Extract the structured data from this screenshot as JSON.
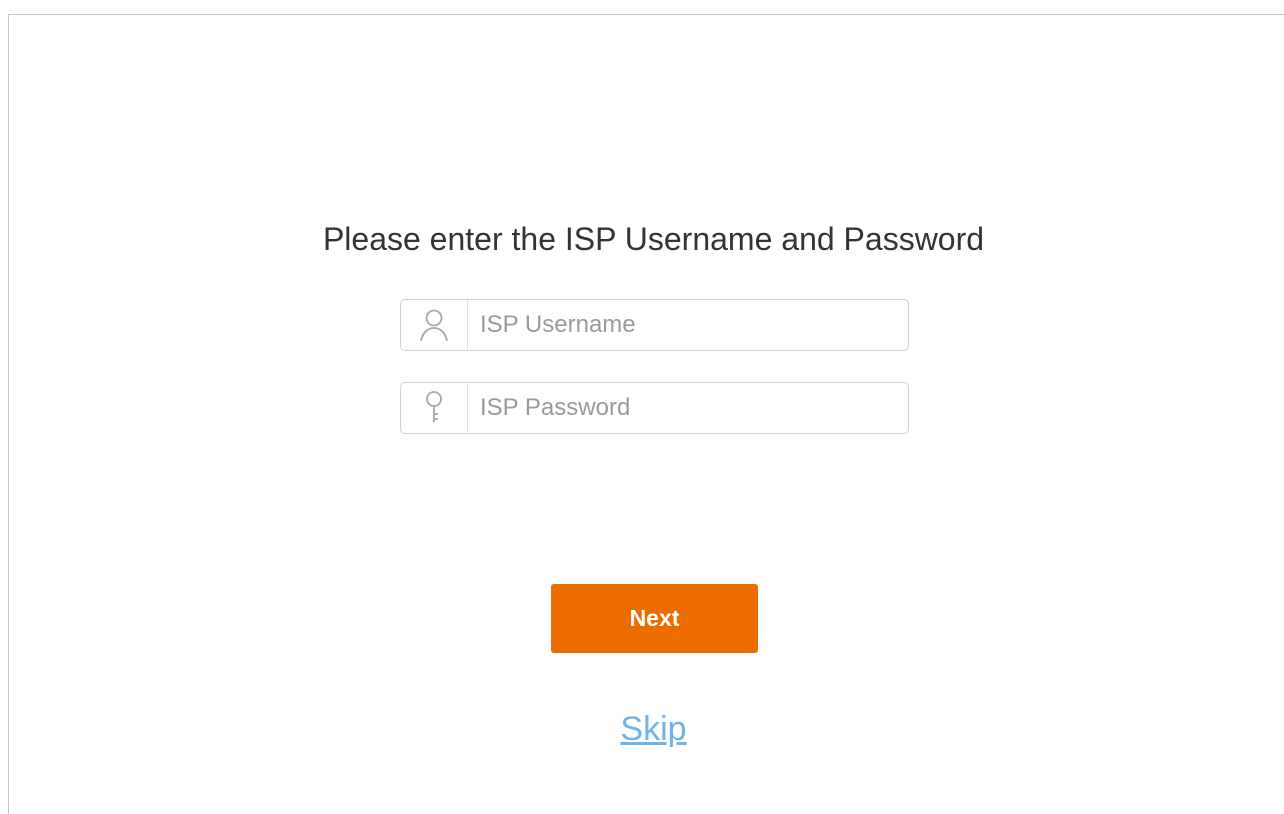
{
  "page": {
    "title": "Please enter the ISP Username and Password"
  },
  "form": {
    "username": {
      "placeholder": "ISP Username",
      "value": "",
      "icon": "user-icon"
    },
    "password": {
      "placeholder": "ISP Password",
      "value": "",
      "icon": "key-icon"
    }
  },
  "actions": {
    "next_label": "Next",
    "skip_label": "Skip"
  },
  "colors": {
    "accent": "#ec6c00",
    "link": "#6fb3e8",
    "text": "#333333",
    "placeholder": "#9a9a9a"
  }
}
